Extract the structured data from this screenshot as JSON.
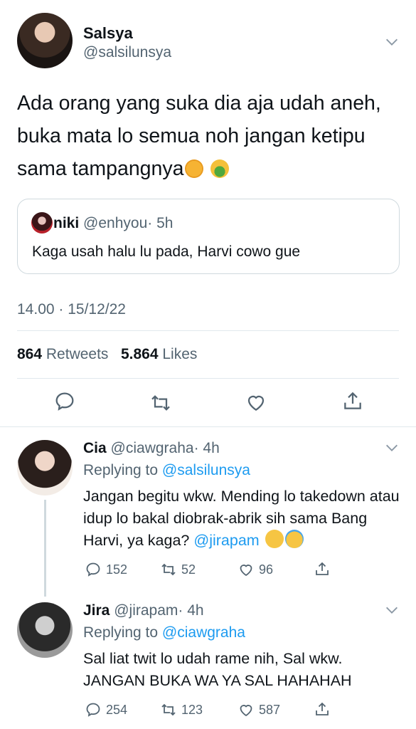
{
  "main_tweet": {
    "name": "Salsya",
    "handle": "@salsilunsya",
    "text": "Ada orang yang suka dia aja udah aneh, buka mata lo semua noh jangan ketipu sama tampangnya",
    "emojis": [
      "face-with-steam-icon",
      "vomiting-face-icon"
    ],
    "quote": {
      "name": "niki",
      "handle": "@enhyou",
      "time": "· 5h",
      "text": "Kaga usah halu lu pada, Harvi cowo gue"
    },
    "timestamp": "14.00 · 15/12/22",
    "retweets_count": "864",
    "retweets_label": "Retweets",
    "likes_count": "5.864",
    "likes_label": "Likes",
    "actions": [
      "reply-icon",
      "retweet-icon",
      "like-icon",
      "share-icon"
    ]
  },
  "replies": [
    {
      "name": "Cia",
      "handle": "@ciawgraha",
      "time": "· 4h",
      "replying_label": "Replying to",
      "replying_to": "@salsilunsya",
      "text": "Jangan begitu wkw. Mending lo takedown atau idup lo bakal diobrak-abrik sih sama Bang Harvi, ya kaga?",
      "mention": "@jirapam",
      "reply_count": "152",
      "retweet_count": "52",
      "like_count": "96"
    },
    {
      "name": "Jira",
      "handle": "@jirapam",
      "time": "· 4h",
      "replying_label": "Replying to",
      "replying_to": "@ciawgraha",
      "text": "Sal liat twit lo udah rame nih, Sal wkw. JANGAN BUKA WA YA SAL HAHAHAH",
      "reply_count": "254",
      "retweet_count": "123",
      "like_count": "587"
    }
  ],
  "colors": {
    "accent": "#1d9bf0",
    "secondary_text": "#536471",
    "border": "#cfd9de"
  }
}
